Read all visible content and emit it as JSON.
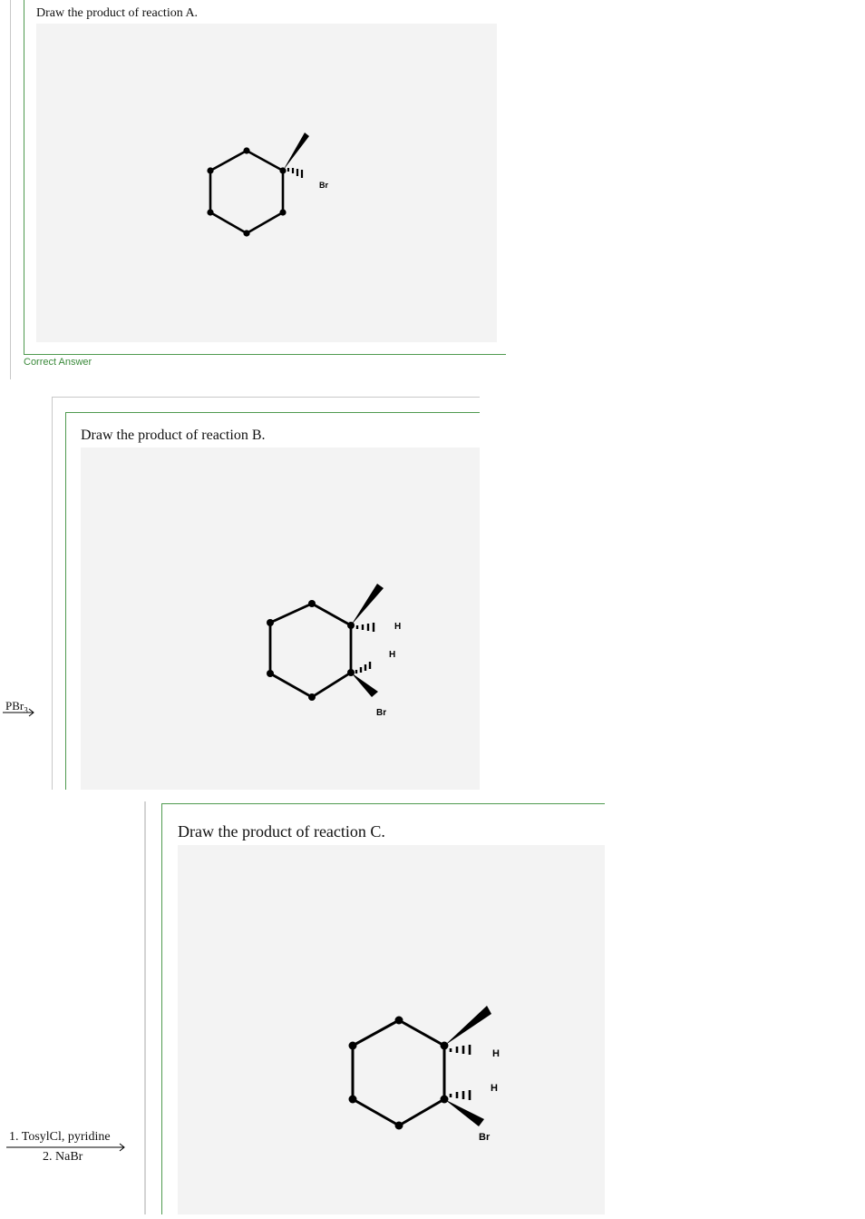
{
  "reaction_a": {
    "prompt": "Draw the product of reaction A.",
    "status": "Correct Answer",
    "atom_labels": [
      "Br"
    ]
  },
  "reaction_b": {
    "prompt": "Draw the product of reaction B.",
    "reagent": "PBr3",
    "reagent_main": "PBr",
    "reagent_sub": "3",
    "atom_labels": [
      "H",
      "H",
      "Br"
    ]
  },
  "reaction_c": {
    "prompt": "Draw the product of reaction C.",
    "reagent_step1": "1. TosylCl, pyridine",
    "reagent_step2": "2. NaBr",
    "atom_labels": [
      "H",
      "H",
      "Br"
    ]
  },
  "colors": {
    "panel_border_green": "#4f9a4f",
    "canvas_bg": "#f3f3f3",
    "status_green": "#3b8a3b"
  }
}
